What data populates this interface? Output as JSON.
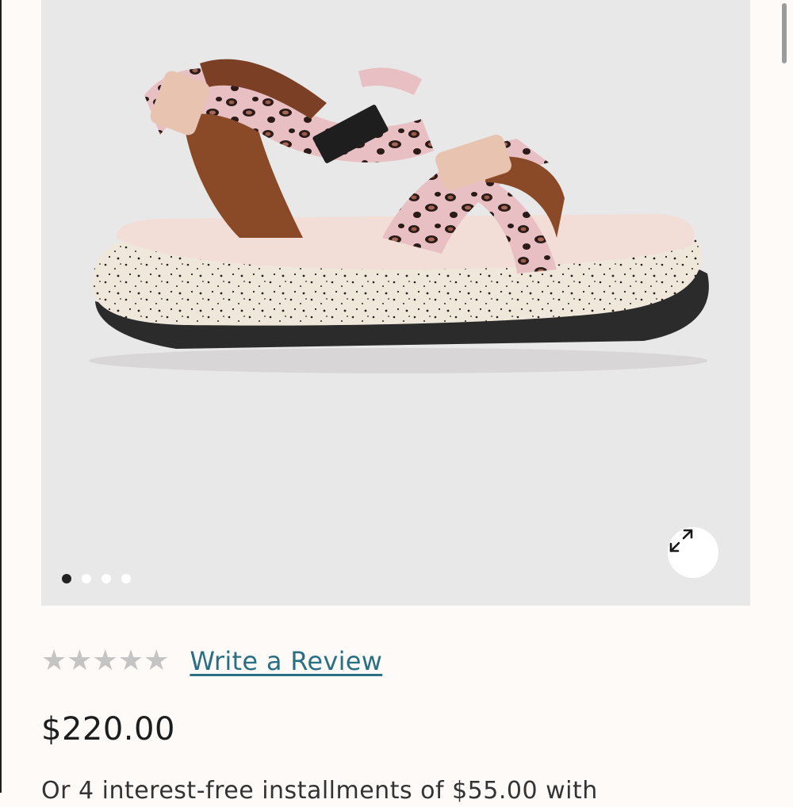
{
  "product": {
    "image_alt": "Leopard print sport sandal",
    "gallery": {
      "dot_count": 4,
      "active_index": 0
    },
    "icons": {
      "expand": "expand-arrows-icon",
      "star": "star-icon"
    },
    "rating": {
      "stars_filled": 0,
      "stars_total": 5,
      "write_review_label": "Write a Review"
    },
    "price": "$220.00",
    "installments_text": "Or 4 interest-free installments of $55.00 with"
  },
  "colors": {
    "link": "#2a6f82",
    "star_empty": "#c4c4c4",
    "dot_active": "#222222",
    "dot_inactive": "#ffffff"
  }
}
